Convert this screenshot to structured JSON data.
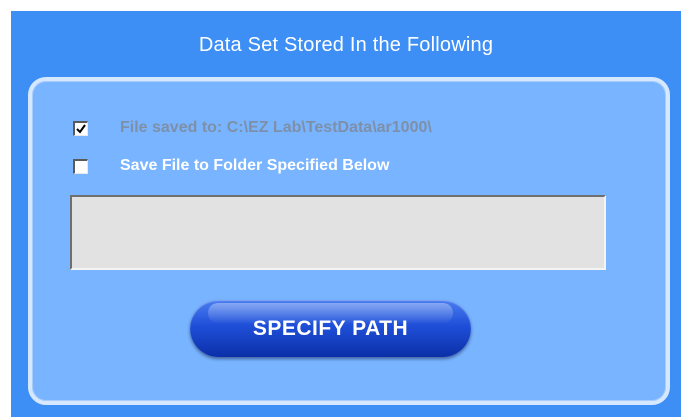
{
  "window": {
    "title": "Data Set Stored In the Following"
  },
  "options": [
    {
      "label": "File saved to: C:\\EZ Lab\\TestData\\ar1000\\",
      "checked": true,
      "enabled": false
    },
    {
      "label": "Save File to Folder Specified Below",
      "checked": false,
      "enabled": true
    }
  ],
  "path_field": {
    "value": ""
  },
  "buttons": {
    "specify_path_label": "SPECIFY PATH"
  },
  "colors": {
    "window_bg": "#3d8ff5",
    "panel_bg": "#78b4ff",
    "button_blue": "#1f4fd8"
  }
}
